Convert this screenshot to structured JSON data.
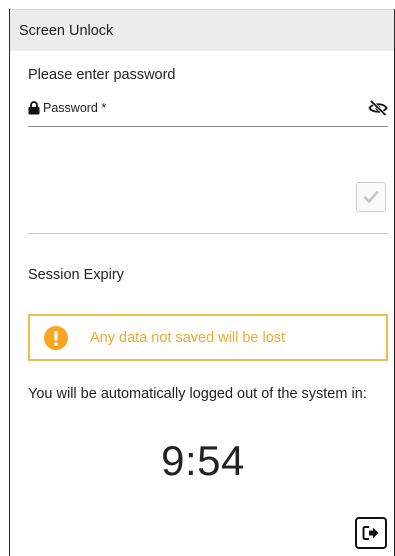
{
  "window": {
    "title": "Screen Unlock"
  },
  "unlock": {
    "prompt": "Please enter password",
    "password_label": "Password *",
    "password_value": "",
    "lock_icon": "lock-icon",
    "visibility_icon": "eye-slash-icon",
    "confirm_icon": "checkmark-icon"
  },
  "session": {
    "title": "Session Expiry",
    "warning_text": "Any data not saved will be lost",
    "warning_icon": "exclamation-circle-icon",
    "warning_color": "#f6b94a",
    "logout_message": "You will be automatically logged out of the system in:",
    "countdown": "9:54",
    "logout_icon": "sign-out-icon"
  }
}
